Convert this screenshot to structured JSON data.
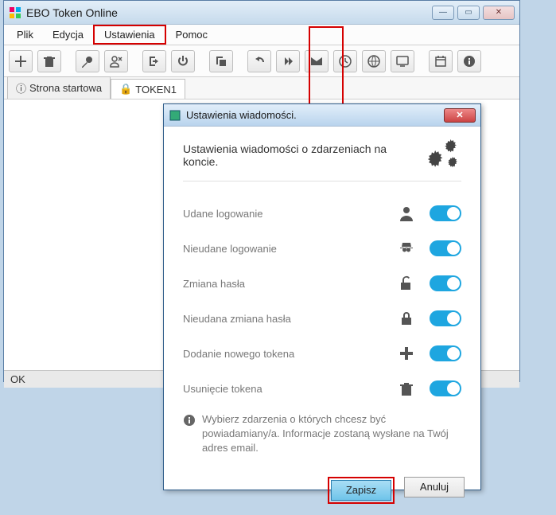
{
  "window": {
    "title": "EBO Token Online",
    "status": "OK"
  },
  "menu": {
    "file": "Plik",
    "edit": "Edycja",
    "settings": "Ustawienia",
    "help": "Pomoc"
  },
  "tabs": {
    "home": "Strona startowa",
    "token": "TOKEN1"
  },
  "dialog": {
    "title": "Ustawienia wiadomości.",
    "heading": "Ustawienia wiadomości o zdarzeniach na koncie.",
    "rows": {
      "r1": "Udane logowanie",
      "r2": "Nieudane logowanie",
      "r3": "Zmiana hasła",
      "r4": "Nieudana zmiana hasła",
      "r5": "Dodanie nowego tokena",
      "r6": "Usunięcie tokena"
    },
    "note": "Wybierz zdarzenia o których chcesz być powiadamiany/a. Informacje zostaną wysłane na Twój adres email.",
    "save": "Zapisz",
    "cancel": "Anuluj"
  }
}
